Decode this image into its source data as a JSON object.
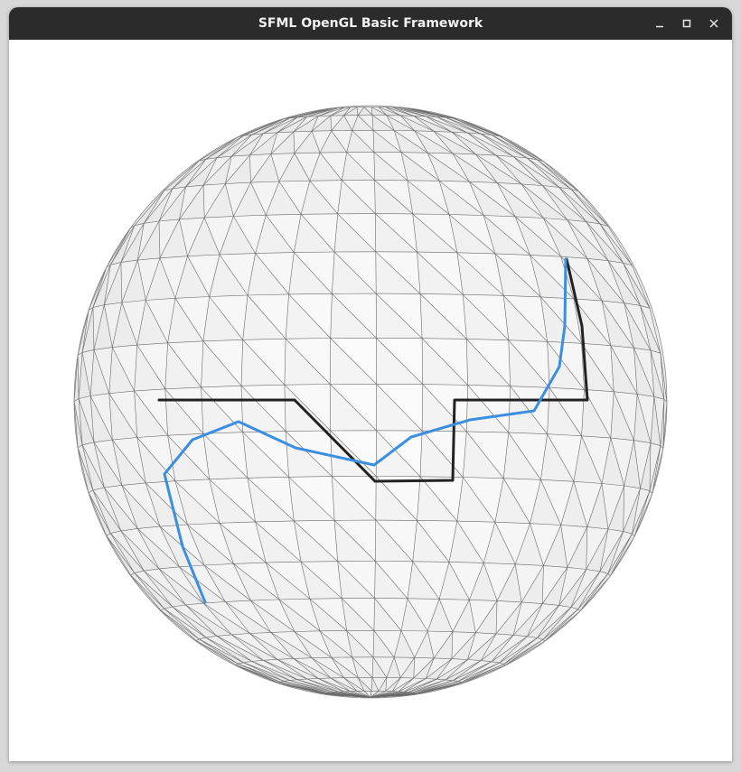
{
  "window": {
    "title": "SFML OpenGL Basic Framework"
  },
  "titlebar": {
    "controls": [
      {
        "name": "minimize",
        "icon": "minimize-icon"
      },
      {
        "name": "maximize",
        "icon": "maximize-icon"
      },
      {
        "name": "close",
        "icon": "close-icon"
      }
    ]
  },
  "scene": {
    "object": "sphere-mesh",
    "colors": {
      "background": "#ffffff",
      "mesh_fill": "#ececec",
      "mesh_edge": "#6a6a6a",
      "path_black": "#222222",
      "path_blue": "#3b8ee0"
    }
  }
}
